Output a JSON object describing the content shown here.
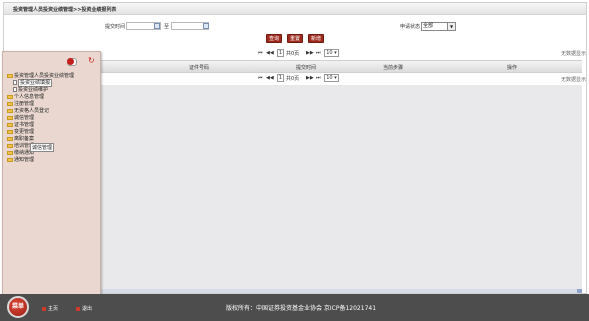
{
  "breadcrumb": "投资管理人员投资业绩管理>>投资业绩报列表",
  "filters": {
    "submit_time_label": "提交时间",
    "to_label": "至",
    "status_label": "申请状态",
    "status_value": "全部"
  },
  "buttons": {
    "query": "查询",
    "reset": "重置",
    "add": "新增"
  },
  "pager_top": {
    "first": "⏮",
    "prev": "◀◀",
    "page": "1",
    "total": "共0页",
    "next": "▶▶",
    "last": "⏭",
    "size": "10"
  },
  "pager_bottom": {
    "first": "⏮",
    "prev": "◀◀",
    "page": "1",
    "total": "共0页",
    "next": "▶▶",
    "last": "⏭",
    "size": "10"
  },
  "no_results": "无数据显示",
  "table": {
    "columns": [
      "证件号码",
      "提交时间",
      "当前步骤",
      "操作"
    ]
  },
  "menu": {
    "items": [
      {
        "label": "投资管理人员投资业绩管理",
        "type": "folder"
      },
      {
        "label": "投资业绩填报",
        "type": "doc"
      },
      {
        "label": "投资业绩维护",
        "type": "doc"
      },
      {
        "label": "个人信息管理",
        "type": "folder"
      },
      {
        "label": "注册管理",
        "type": "folder"
      },
      {
        "label": "无资格人员登记",
        "type": "folder"
      },
      {
        "label": "诚信管理",
        "type": "folder"
      },
      {
        "label": "证书管理",
        "type": "folder"
      },
      {
        "label": "变更管理",
        "type": "folder"
      },
      {
        "label": "离职备案",
        "type": "folder"
      },
      {
        "label": "培训管理",
        "type": "folder"
      },
      {
        "label": "缴纳通知",
        "type": "folder"
      },
      {
        "label": "通知管理",
        "type": "folder"
      }
    ],
    "tooltip": "诚信管理"
  },
  "footer": {
    "menu_label": "菜单",
    "home_label": "主页",
    "logout_label": "退出",
    "copyright": "版权所有：中国证券投资基金业协会 京ICP备12021741"
  }
}
